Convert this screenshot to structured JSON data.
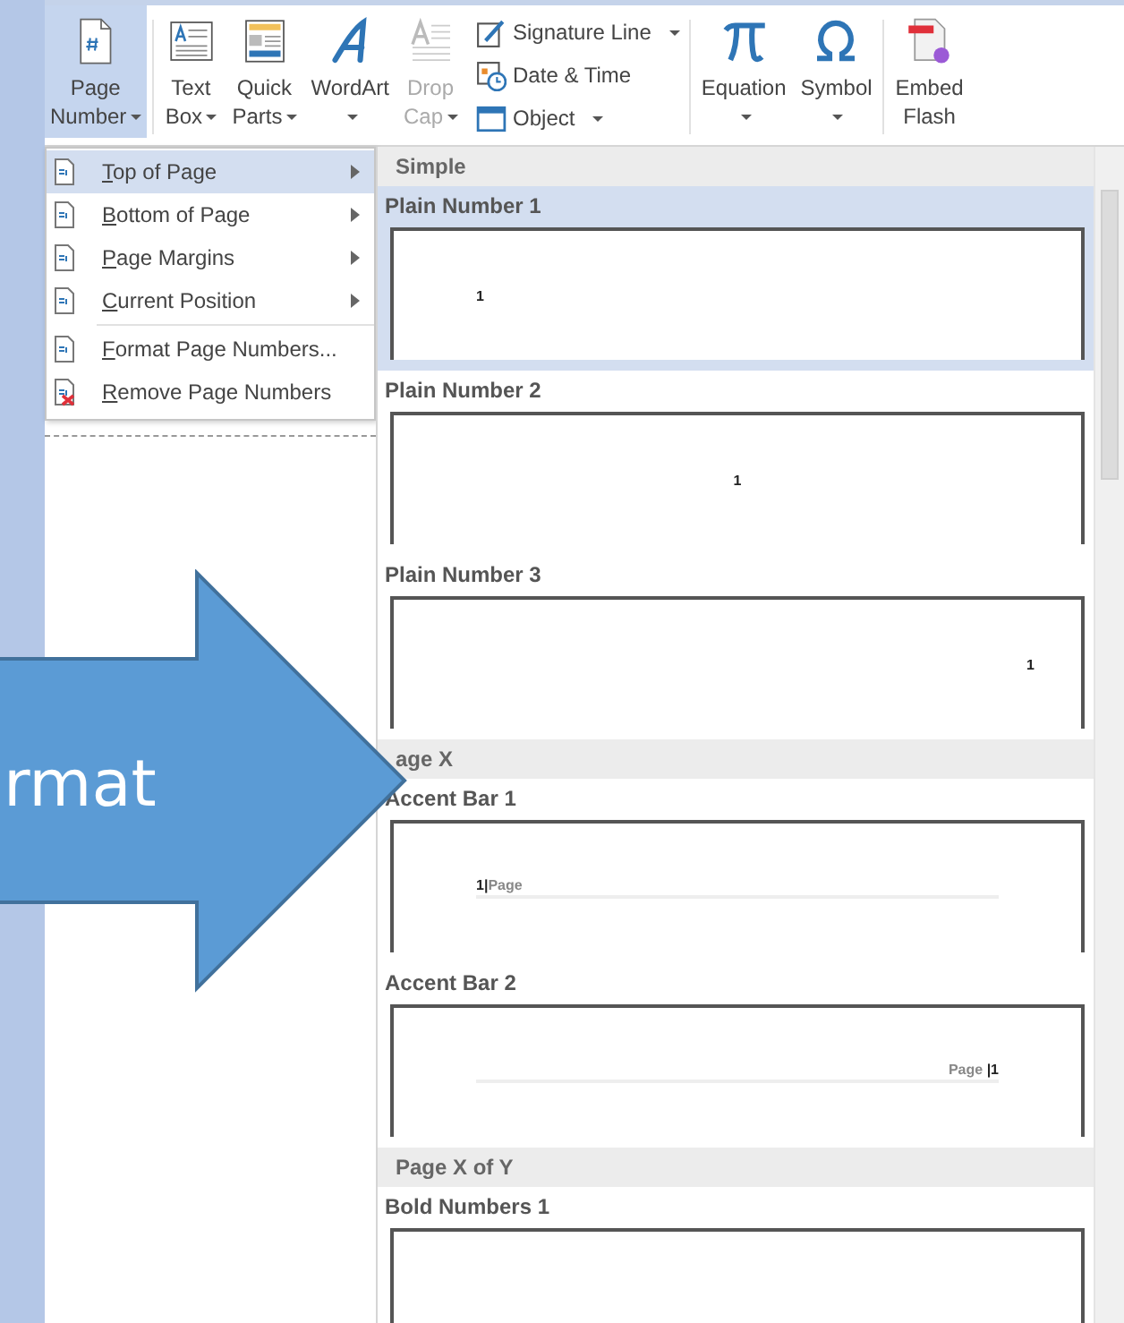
{
  "ribbon": {
    "groups": [
      {
        "buttons": [
          {
            "lines": [
              "Page",
              "Number"
            ],
            "dropdown": true,
            "selected": true,
            "disabled": false
          }
        ]
      },
      {
        "buttons": [
          {
            "lines": [
              "Text",
              "Box"
            ],
            "dropdown": true,
            "selected": false,
            "disabled": false
          },
          {
            "lines": [
              "Quick",
              "Parts"
            ],
            "dropdown": true,
            "selected": false,
            "disabled": false
          },
          {
            "lines": [
              "WordArt"
            ],
            "dropdown": true,
            "selected": false,
            "disabled": false
          },
          {
            "lines": [
              "Drop",
              "Cap"
            ],
            "dropdown": true,
            "selected": false,
            "disabled": true
          }
        ],
        "small_buttons": [
          {
            "label": "Signature Line",
            "dropdown": true
          },
          {
            "label": "Date & Time",
            "dropdown": false
          },
          {
            "label": "Object",
            "dropdown": true
          }
        ]
      },
      {
        "buttons": [
          {
            "lines": [
              "Equation"
            ],
            "dropdown": true,
            "selected": false,
            "disabled": false
          },
          {
            "lines": [
              "Symbol"
            ],
            "dropdown": true,
            "selected": false,
            "disabled": false
          }
        ]
      },
      {
        "buttons": [
          {
            "lines": [
              "Embed",
              "Flash"
            ],
            "dropdown": false,
            "selected": false,
            "disabled": false
          }
        ]
      }
    ]
  },
  "menu": {
    "sections": [
      [
        {
          "label": "Top of Page",
          "submenu": true,
          "selected": true
        },
        {
          "label": "Bottom of Page",
          "submenu": true,
          "selected": false
        },
        {
          "label": "Page Margins",
          "submenu": true,
          "selected": false
        },
        {
          "label": "Current Position",
          "submenu": true,
          "selected": false
        }
      ],
      [
        {
          "label": "Format Page Numbers...",
          "submenu": false,
          "selected": false
        },
        {
          "label": "Remove Page Numbers",
          "submenu": false,
          "selected": false
        }
      ]
    ]
  },
  "gallery": {
    "sections": [
      {
        "title": "Simple",
        "items": [
          {
            "name": "Plain Number 1",
            "selected": true,
            "preview": {
              "kind": "plain",
              "text": "1"
            }
          },
          {
            "name": "Plain Number 2",
            "selected": false,
            "preview": {
              "kind": "plain",
              "text": "1"
            }
          },
          {
            "name": "Plain Number 3",
            "selected": false,
            "preview": {
              "kind": "plain",
              "text": "1"
            }
          }
        ]
      },
      {
        "title": "age X",
        "items": [
          {
            "name": "Accent Bar 1",
            "selected": false,
            "preview": {
              "kind": "accent",
              "text": "**1|**Page"
            }
          },
          {
            "name": "Accent Bar 2",
            "selected": false,
            "preview": {
              "kind": "accent",
              "text": "Page **|1**"
            }
          }
        ]
      },
      {
        "title": "Page X of Y",
        "items": [
          {
            "name": "Bold Numbers 1",
            "selected": false
          }
        ]
      }
    ]
  },
  "overlay_arrow": {
    "text": "rmat"
  }
}
